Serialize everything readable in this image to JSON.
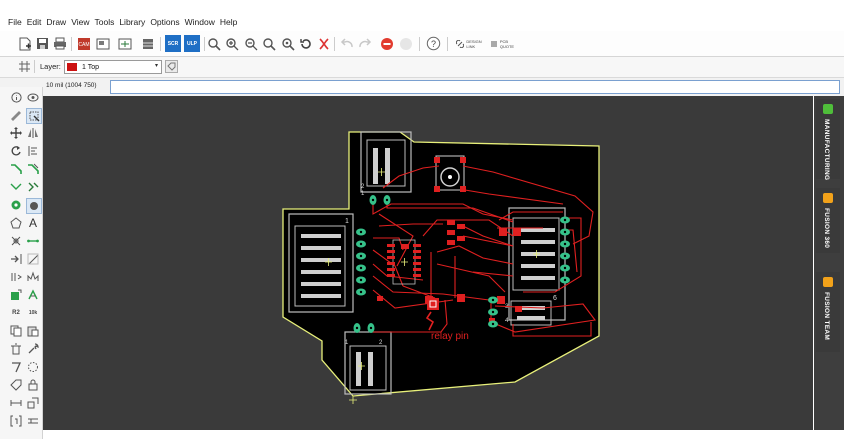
{
  "menu": [
    "File",
    "Edit",
    "Draw",
    "View",
    "Tools",
    "Library",
    "Options",
    "Window",
    "Help"
  ],
  "toolbar": {
    "scr_label": "SCR",
    "ulp_label": "ULP",
    "design_link": [
      "DESIGN",
      "LINK"
    ],
    "pcb_quote": [
      "PCB",
      "QUOTE"
    ]
  },
  "layer": {
    "label": "Layer:",
    "value": "1 Top",
    "color": "#cc1111"
  },
  "command": {
    "coordinates": "10 mil (1004 750)",
    "input_value": ""
  },
  "board": {
    "annotation": "relay pin",
    "pin_numbers": [
      "1",
      "2",
      "1",
      "2",
      "1",
      "3",
      "4",
      "6"
    ],
    "trace_color": "#e02020",
    "pad_color": "#36c28a",
    "outline_color": "#e8f07a"
  },
  "side_tabs": [
    {
      "label": "MANUFACTURING",
      "icon_color": "#4fbe3a"
    },
    {
      "label": "FUSION 360",
      "icon_color": "#f2a21a"
    },
    {
      "label": "FUSION TEAM",
      "icon_color": "#f2a21a"
    }
  ]
}
